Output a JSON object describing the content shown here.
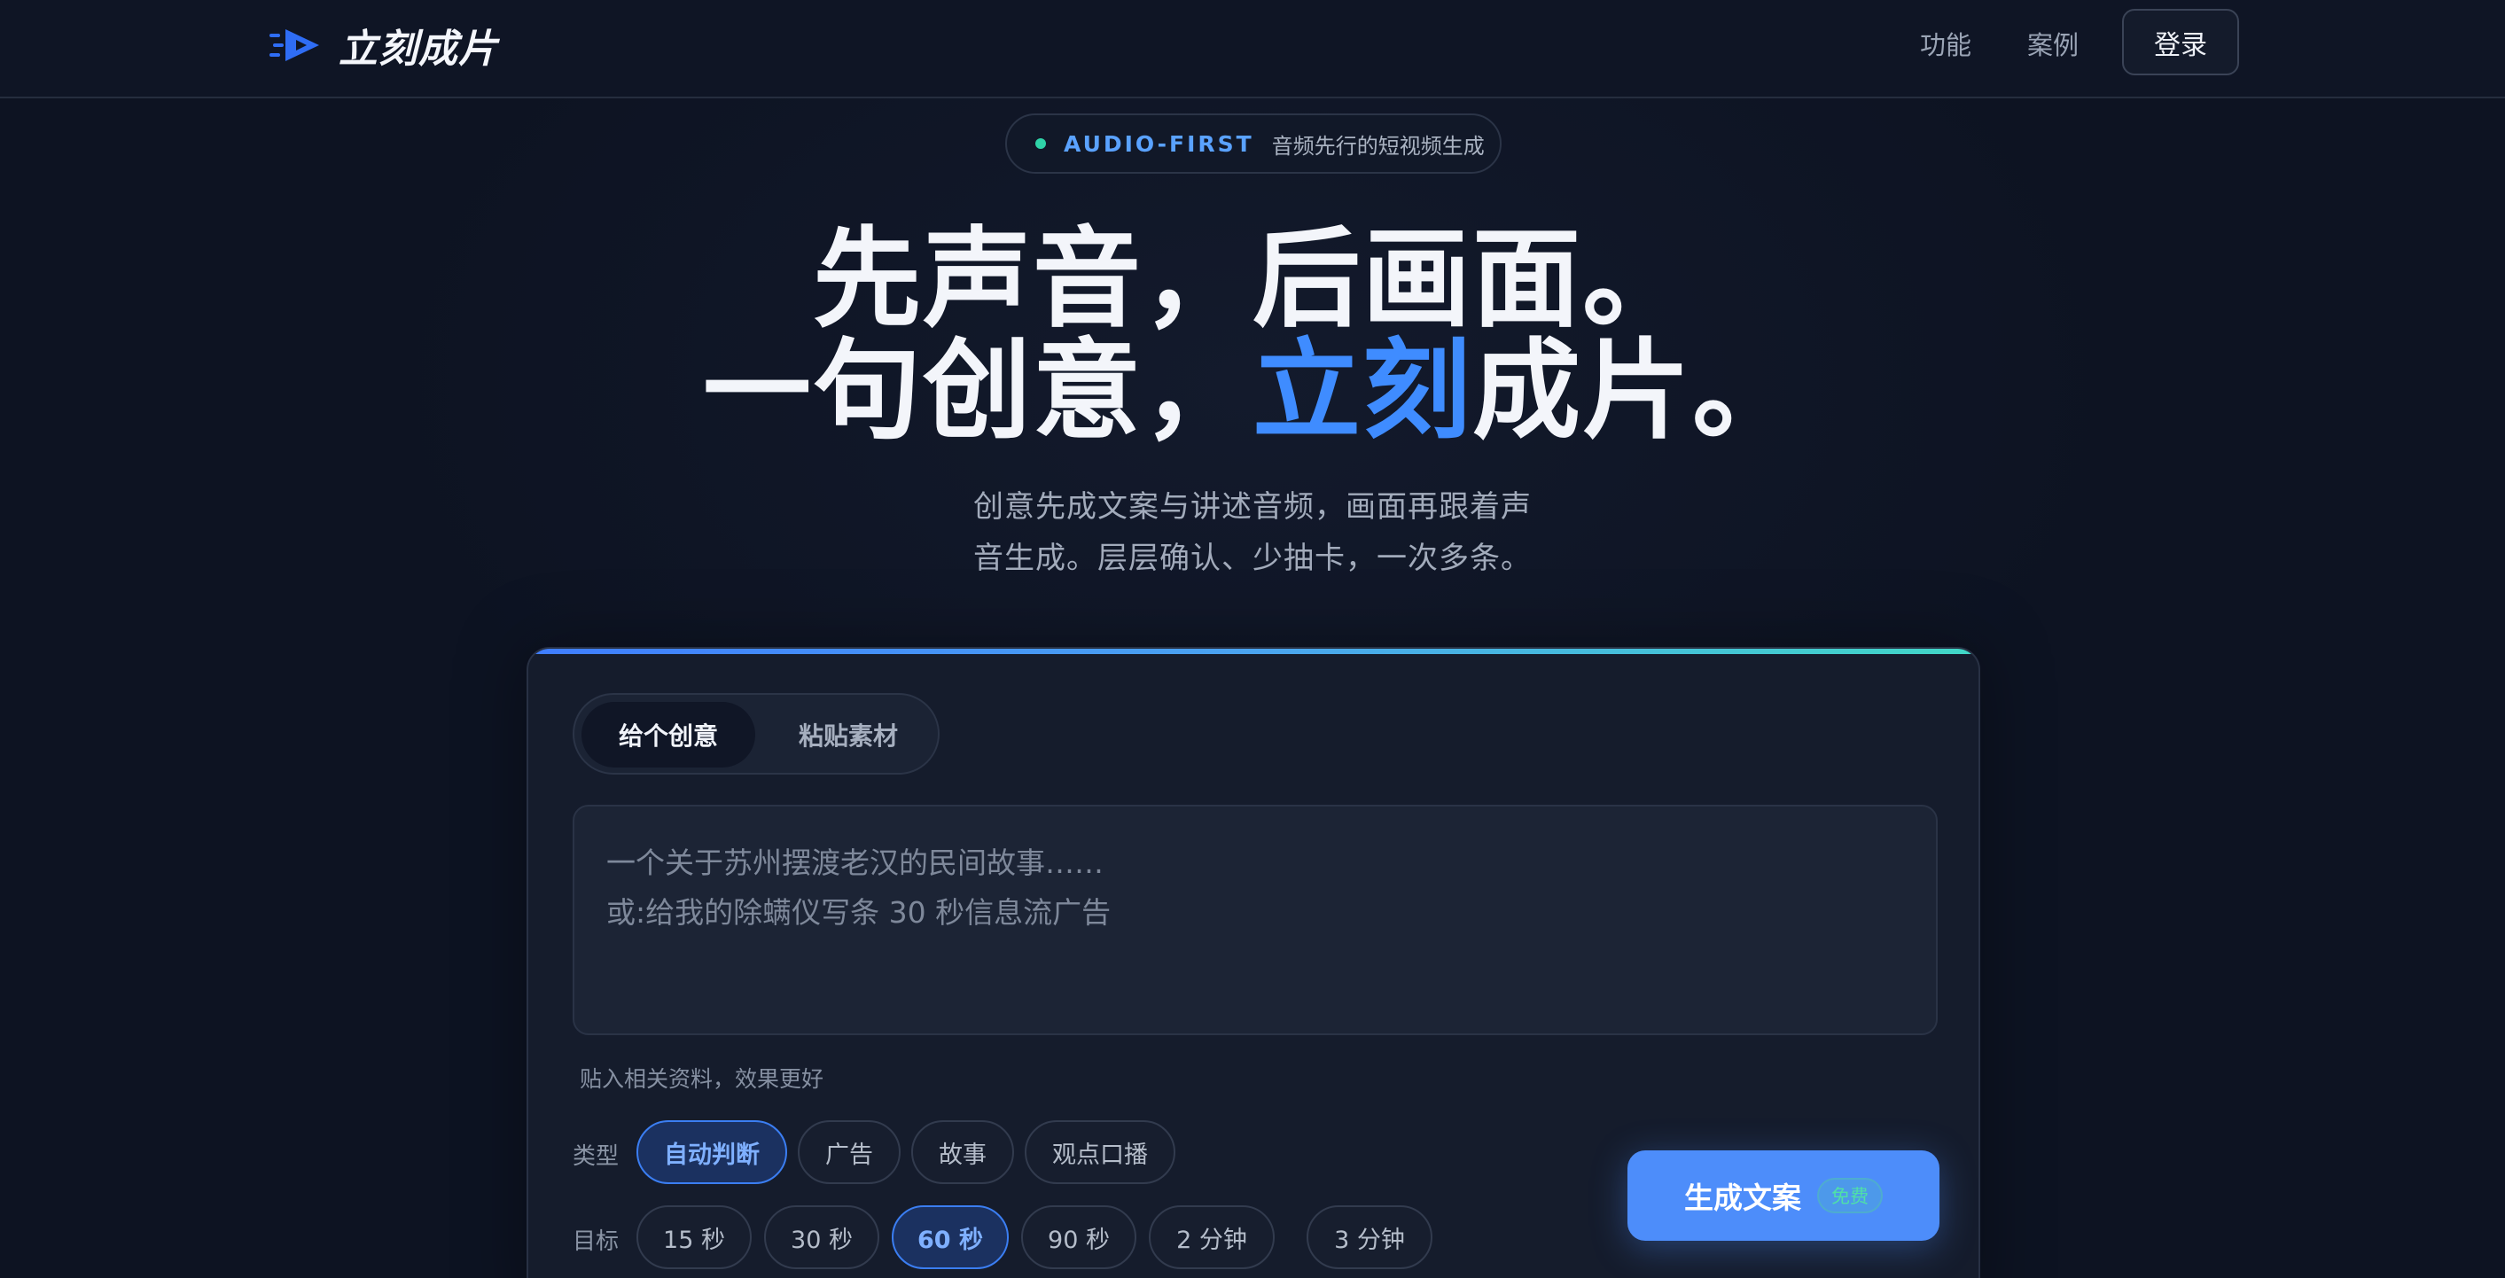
{
  "brand": {
    "name": "立刻成片",
    "logo_icon": "play-arrow-speed-icon",
    "color": "#2f6df5"
  },
  "nav": {
    "features": "功能",
    "cases": "案例",
    "login": "登录"
  },
  "badge": {
    "tag": "AUDIO-FIRST",
    "text": "音频先行的短视频生成"
  },
  "hero": {
    "line1": "先声音，后画面。",
    "line2_prefix": "一句创意，",
    "line2_accent": "立刻",
    "line2_suffix": "成片。",
    "sub1": "创意先成文案与讲述音频，画面再跟着声",
    "sub2": "音生成。层层确认、少抽卡，一次多条。"
  },
  "composer": {
    "tabs": [
      {
        "label": "给个创意",
        "active": true
      },
      {
        "label": "粘贴素材",
        "active": false
      }
    ],
    "placeholder_line1": "一个关于苏州摆渡老汉的民间故事……",
    "placeholder_line2": "或:给我的除螨仪写条 30 秒信息流广告",
    "hint": "贴入相关资料，效果更好",
    "type_label": "类型",
    "types": [
      {
        "label": "自动判断",
        "selected": true
      },
      {
        "label": "广告",
        "selected": false
      },
      {
        "label": "故事",
        "selected": false
      },
      {
        "label": "观点口播",
        "selected": false
      }
    ],
    "target_label": "目标",
    "targets": [
      {
        "label": "15 秒",
        "selected": false
      },
      {
        "label": "30 秒",
        "selected": false
      },
      {
        "label": "60 秒",
        "selected": true
      },
      {
        "label": "90 秒",
        "selected": false
      },
      {
        "label": "2 分钟",
        "selected": false
      },
      {
        "label": "3 分钟",
        "selected": false
      }
    ],
    "generate_label": "生成文案",
    "generate_badge": "免费"
  },
  "colors": {
    "accent": "#3f8cff",
    "button": "#4d8dfa",
    "badge_dot": "#2fd3a8"
  }
}
